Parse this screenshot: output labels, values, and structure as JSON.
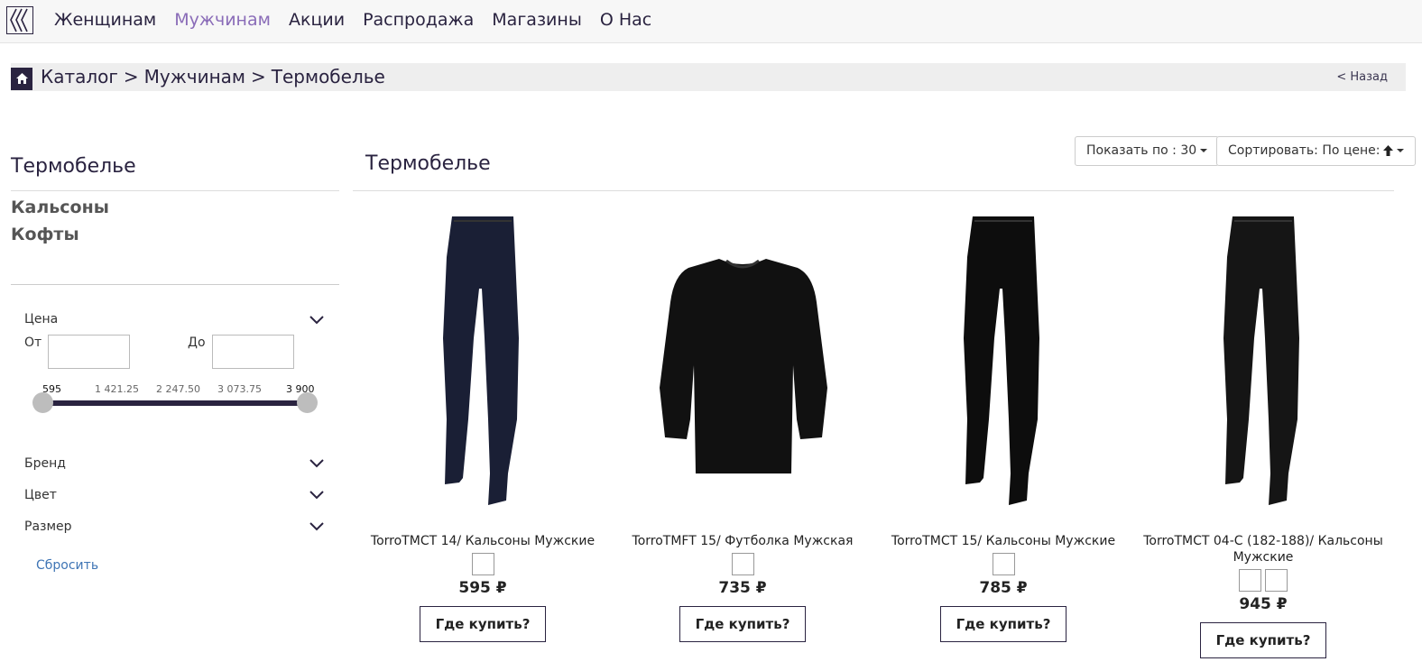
{
  "nav": {
    "items": [
      {
        "label": "Женщинам",
        "active": false
      },
      {
        "label": "Мужчинам",
        "active": true
      },
      {
        "label": "Акции",
        "active": false
      },
      {
        "label": "Распродажа",
        "active": false
      },
      {
        "label": "Магазины",
        "active": false
      },
      {
        "label": "О Нас",
        "active": false
      }
    ]
  },
  "breadcrumb": {
    "items": [
      "Каталог",
      ">",
      "Мужчинам",
      ">",
      "Термобелье"
    ],
    "back": "< Назад"
  },
  "sidebar": {
    "title": "Термобелье",
    "categories": [
      "Кальсоны",
      "Кофты"
    ],
    "price_filter": {
      "label": "Цена",
      "from_label": "От",
      "to_label": "До",
      "from_value": "",
      "to_value": "",
      "ticks": [
        "595",
        "1 421.25",
        "2 247.50",
        "3 073.75",
        "3 900"
      ],
      "range_min": 595,
      "range_max": 3900,
      "selected_min": 595,
      "selected_max": 3900
    },
    "filters": [
      "Бренд",
      "Цвет",
      "Размер"
    ],
    "reset": "Сбросить"
  },
  "main": {
    "title": "Термобелье",
    "show_per_page": "Показать по : 30",
    "sort": "Сортировать: По цене:"
  },
  "products": [
    {
      "name": "TorroTMCT 14/ Кальсоны Мужские",
      "price": "595 ₽",
      "buy": "Где купить?",
      "swatches": 1,
      "type": "pants",
      "color": "#1a1f35"
    },
    {
      "name": "TorroTMFT 15/ Футболка Мужская",
      "price": "735 ₽",
      "buy": "Где купить?",
      "swatches": 1,
      "type": "shirt",
      "color": "#111111"
    },
    {
      "name": "TorroTMCT 15/ Кальсоны Мужские",
      "price": "785 ₽",
      "buy": "Где купить?",
      "swatches": 1,
      "type": "pants",
      "color": "#0d0d0d"
    },
    {
      "name": "TorroTMCT 04-C (182-188)/ Кальсоны Мужские",
      "price": "945 ₽",
      "buy": "Где купить?",
      "swatches": 2,
      "type": "pants",
      "color": "#151515"
    }
  ],
  "colors": {
    "accent": "#2a2340",
    "active_nav": "#8a6cb8",
    "link": "#3f75b5"
  }
}
